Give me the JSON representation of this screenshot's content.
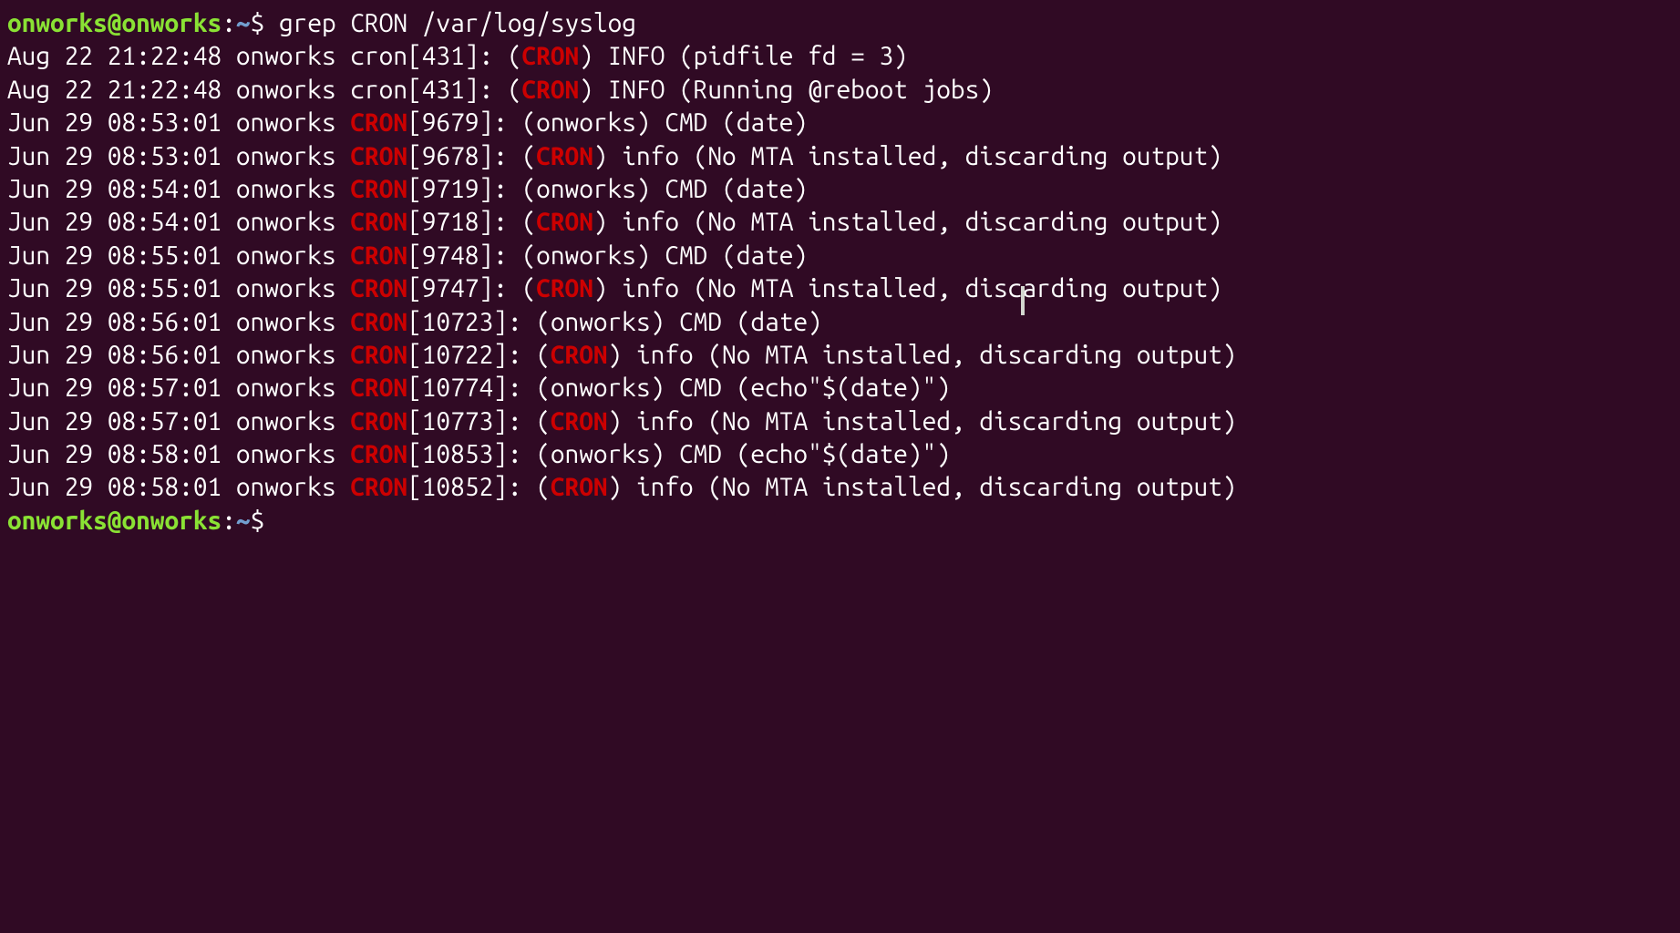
{
  "prompt": {
    "user_host": "onworks@onworks",
    "colon": ":",
    "path": "~",
    "dollar": "$"
  },
  "command": "grep CRON /var/log/syslog",
  "highlight_token": "CRON",
  "log_lines": [
    {
      "pre": "Aug 22 21:22:48 onworks cron[431]: (",
      "match": "CRON",
      "post": ") INFO (pidfile fd = 3)"
    },
    {
      "pre": "Aug 22 21:22:48 onworks cron[431]: (",
      "match": "CRON",
      "post": ") INFO (Running @reboot jobs)"
    },
    {
      "pre": "Jun 29 08:53:01 onworks ",
      "match": "CRON",
      "post": "[9679]: (onworks) CMD (date)"
    },
    {
      "pre": "Jun 29 08:53:01 onworks ",
      "match": "CRON",
      "post": "[9678]: (",
      "match2": "CRON",
      "post2": ") info (No MTA installed, discarding output)"
    },
    {
      "pre": "Jun 29 08:54:01 onworks ",
      "match": "CRON",
      "post": "[9719]: (onworks) CMD (date)"
    },
    {
      "pre": "Jun 29 08:54:01 onworks ",
      "match": "CRON",
      "post": "[9718]: (",
      "match2": "CRON",
      "post2": ") info (No MTA installed, discarding output)"
    },
    {
      "pre": "Jun 29 08:55:01 onworks ",
      "match": "CRON",
      "post": "[9748]: (onworks) CMD (date)"
    },
    {
      "pre": "Jun 29 08:55:01 onworks ",
      "match": "CRON",
      "post": "[9747]: (",
      "match2": "CRON",
      "post2": ") info (No MTA installed, discarding output)"
    },
    {
      "pre": "Jun 29 08:56:01 onworks ",
      "match": "CRON",
      "post": "[10723]: (onworks) CMD (date)"
    },
    {
      "pre": "Jun 29 08:56:01 onworks ",
      "match": "CRON",
      "post": "[10722]: (",
      "match2": "CRON",
      "post2": ") info (No MTA installed, discarding output)"
    },
    {
      "pre": "Jun 29 08:57:01 onworks ",
      "match": "CRON",
      "post": "[10774]: (onworks) CMD (echo\"$(date)\")"
    },
    {
      "pre": "Jun 29 08:57:01 onworks ",
      "match": "CRON",
      "post": "[10773]: (",
      "match2": "CRON",
      "post2": ") info (No MTA installed, discarding output)"
    },
    {
      "pre": "Jun 29 08:58:01 onworks ",
      "match": "CRON",
      "post": "[10853]: (onworks) CMD (echo\"$(date)\")"
    },
    {
      "pre": "Jun 29 08:58:01 onworks ",
      "match": "CRON",
      "post": "[10852]: (",
      "match2": "CRON",
      "post2": ") info (No MTA installed, discarding output)"
    }
  ]
}
